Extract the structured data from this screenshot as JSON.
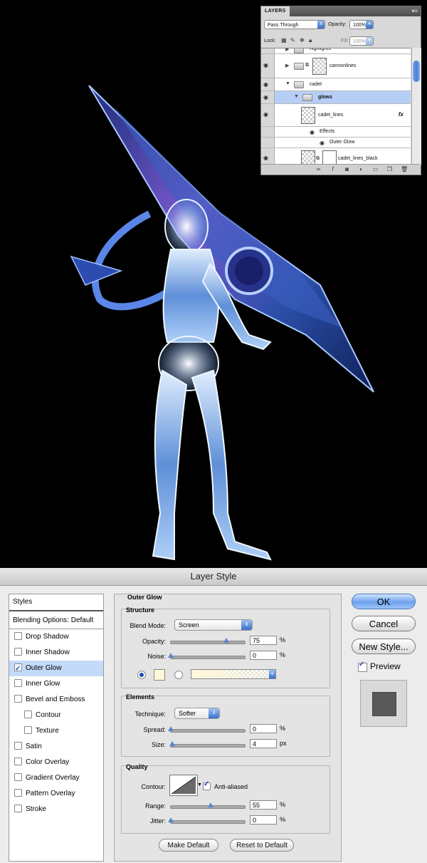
{
  "layers_panel": {
    "tab": "LAYERS",
    "blend_mode": "Pass Through",
    "opacity_label": "Opacity:",
    "opacity_value": "100%",
    "lock_label": "Lock:",
    "fill_label": "Fill:",
    "fill_value": "100%",
    "rows": [
      {
        "name": "highlights"
      },
      {
        "name": "cannonlines"
      },
      {
        "name": "cadet"
      },
      {
        "name": "glows"
      },
      {
        "name": "cadet_lines"
      },
      {
        "name": "Effects"
      },
      {
        "name": "Outer Glow"
      },
      {
        "name": "cadet_lines_black"
      }
    ],
    "fx": "fx"
  },
  "dialog": {
    "title": "Layer Style",
    "styles_header": "Styles",
    "blending_options": "Blending Options: Default",
    "style_items": [
      {
        "label": "Drop Shadow",
        "checked": false
      },
      {
        "label": "Inner Shadow",
        "checked": false
      },
      {
        "label": "Outer Glow",
        "checked": true
      },
      {
        "label": "Inner Glow",
        "checked": false
      },
      {
        "label": "Bevel and Emboss",
        "checked": false
      },
      {
        "label": "Contour",
        "checked": false
      },
      {
        "label": "Texture",
        "checked": false
      },
      {
        "label": "Satin",
        "checked": false
      },
      {
        "label": "Color Overlay",
        "checked": false
      },
      {
        "label": "Gradient Overlay",
        "checked": false
      },
      {
        "label": "Pattern Overlay",
        "checked": false
      },
      {
        "label": "Stroke",
        "checked": false
      }
    ],
    "section_title": "Outer Glow",
    "structure": {
      "title": "Structure",
      "blend_mode_label": "Blend Mode:",
      "blend_mode": "Screen",
      "opacity_label": "Opacity:",
      "opacity": "75",
      "opacity_level": 0.75,
      "noise_label": "Noise:",
      "noise": "0",
      "noise_level": 0,
      "pct": "%",
      "glow_color": "#fff8d6"
    },
    "elements": {
      "title": "Elements",
      "technique_label": "Technique:",
      "technique": "Softer",
      "spread_label": "Spread:",
      "spread": "0",
      "size_label": "Size:",
      "size": "4",
      "pct": "%",
      "px": "px"
    },
    "quality": {
      "title": "Quality",
      "contour_label": "Contour:",
      "anti_aliased": "Anti-aliased",
      "range_label": "Range:",
      "range": "55",
      "jitter_label": "Jitter:",
      "jitter": "0",
      "pct": "%"
    },
    "make_default": "Make Default",
    "reset_default": "Reset to Default",
    "ok": "OK",
    "cancel": "Cancel",
    "new_style": "New Style...",
    "preview": "Preview"
  }
}
